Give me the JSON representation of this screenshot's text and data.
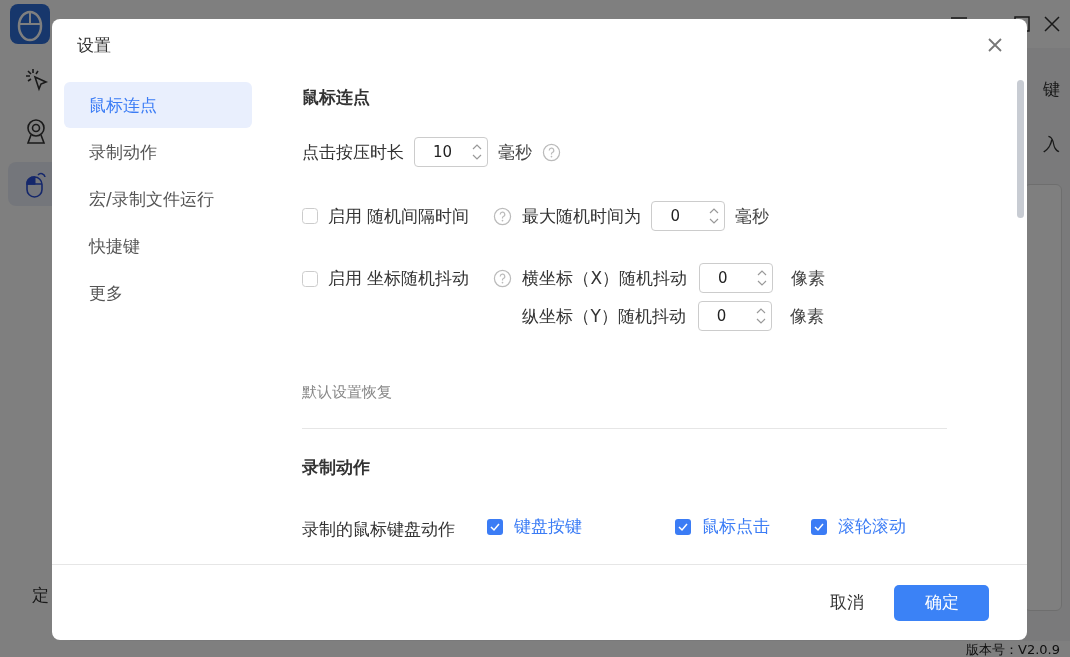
{
  "app": {
    "sidebar": [
      {
        "kind": "click",
        "selected": false
      },
      {
        "kind": "camera",
        "selected": false
      },
      {
        "kind": "mouse",
        "selected": true
      }
    ],
    "sidebar_label": "定",
    "toolbar_labels": [
      "键",
      "入"
    ],
    "version": "版本号：V2.0.9"
  },
  "dialog": {
    "title": "设置",
    "nav": [
      {
        "label": "鼠标连点",
        "selected": true
      },
      {
        "label": "录制动作",
        "selected": false
      },
      {
        "label": "宏/录制文件运行",
        "selected": false
      },
      {
        "label": "快捷键",
        "selected": false
      },
      {
        "label": "更多",
        "selected": false
      }
    ],
    "click_section": {
      "title": "鼠标连点",
      "press": {
        "label": "点击按压时长",
        "value": "10",
        "unit": "毫秒"
      },
      "random_interval": {
        "checked": false,
        "label": "启用 随机间隔时间",
        "max_label": "最大随机时间为",
        "value": "0",
        "unit": "毫秒"
      },
      "jitter": {
        "checked": false,
        "label": "启用 坐标随机抖动",
        "axes": [
          {
            "label": "横坐标（X）随机抖动",
            "value": "0",
            "unit": "像素"
          },
          {
            "label": "纵坐标（Y）随机抖动",
            "value": "0",
            "unit": "像素"
          }
        ]
      },
      "reset_link": "默认设置恢复"
    },
    "record_section": {
      "title": "录制动作",
      "label": "录制的鼠标键盘动作",
      "options": [
        {
          "label": "键盘按键",
          "checked": true
        },
        {
          "label": "鼠标点击",
          "checked": true
        },
        {
          "label": "滚轮滚动",
          "checked": true
        }
      ]
    },
    "buttons": {
      "cancel": "取消",
      "ok": "确定"
    }
  }
}
